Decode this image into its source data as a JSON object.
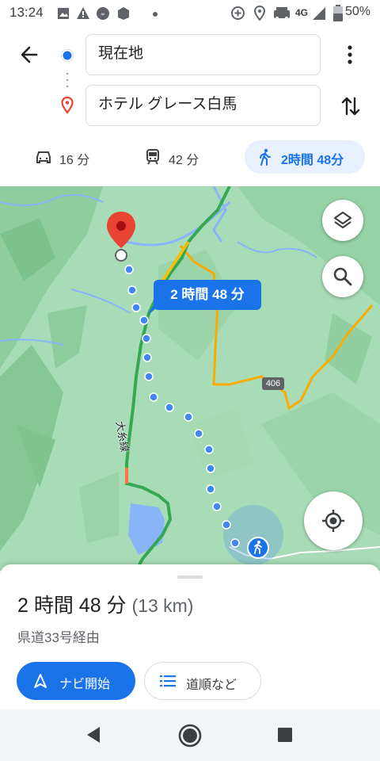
{
  "status_bar": {
    "time": "13:24",
    "network": "4G",
    "battery": "50%",
    "icons": [
      "image-icon",
      "warning-icon",
      "app-icon",
      "app-icon-2",
      "dot-icon",
      "data-saver-icon",
      "location-icon",
      "car-icon",
      "signal-icon",
      "battery-icon"
    ]
  },
  "directions": {
    "origin": "現在地",
    "destination": "ホテル グレース白馬"
  },
  "modes": [
    {
      "name": "car",
      "label": "16 分",
      "icon": "car-icon"
    },
    {
      "name": "transit",
      "label": "42 分",
      "icon": "train-icon"
    },
    {
      "name": "walk",
      "label": "2時間 48分",
      "icon": "walk-icon",
      "active": true
    }
  ],
  "map": {
    "callout": "2 時間 48 分",
    "road_label": "大糸線",
    "route_badge": "406"
  },
  "summary": {
    "duration": "2 時間 48 分",
    "distance": "(13 km)",
    "via": "県道33号経由",
    "start_label": "ナビ開始",
    "steps_label": "道順など"
  },
  "colors": {
    "accent": "#1a73e8",
    "map_green": "#9fd6ad",
    "pin_red": "#ea4335"
  }
}
